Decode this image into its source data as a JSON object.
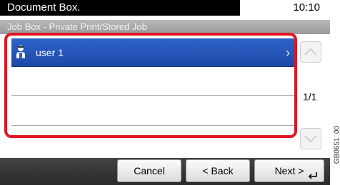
{
  "header": {
    "title": "Document Box.",
    "time": "10:10"
  },
  "subheader": {
    "text": "Job Box - Private Print/Stored Job"
  },
  "list": {
    "rows": [
      {
        "label": "user 1",
        "selected": true
      },
      {
        "label": "",
        "selected": false
      },
      {
        "label": "",
        "selected": false
      },
      {
        "label": "",
        "selected": false
      }
    ]
  },
  "pagination": {
    "indicator": "1/1"
  },
  "footer": {
    "cancel_label": "Cancel",
    "back_label": "< Back",
    "next_label": "Next >"
  },
  "side_code": "GB0651_00",
  "colors": {
    "selected_row": "#1c49a8",
    "focus_border": "#e01522",
    "header_bg": "#000000"
  },
  "icons": {
    "user": "person-icon",
    "row_chevron": "chevron-right-icon",
    "scroll_up": "chevron-up-icon",
    "scroll_down": "chevron-down-icon",
    "enter": "enter-icon"
  }
}
